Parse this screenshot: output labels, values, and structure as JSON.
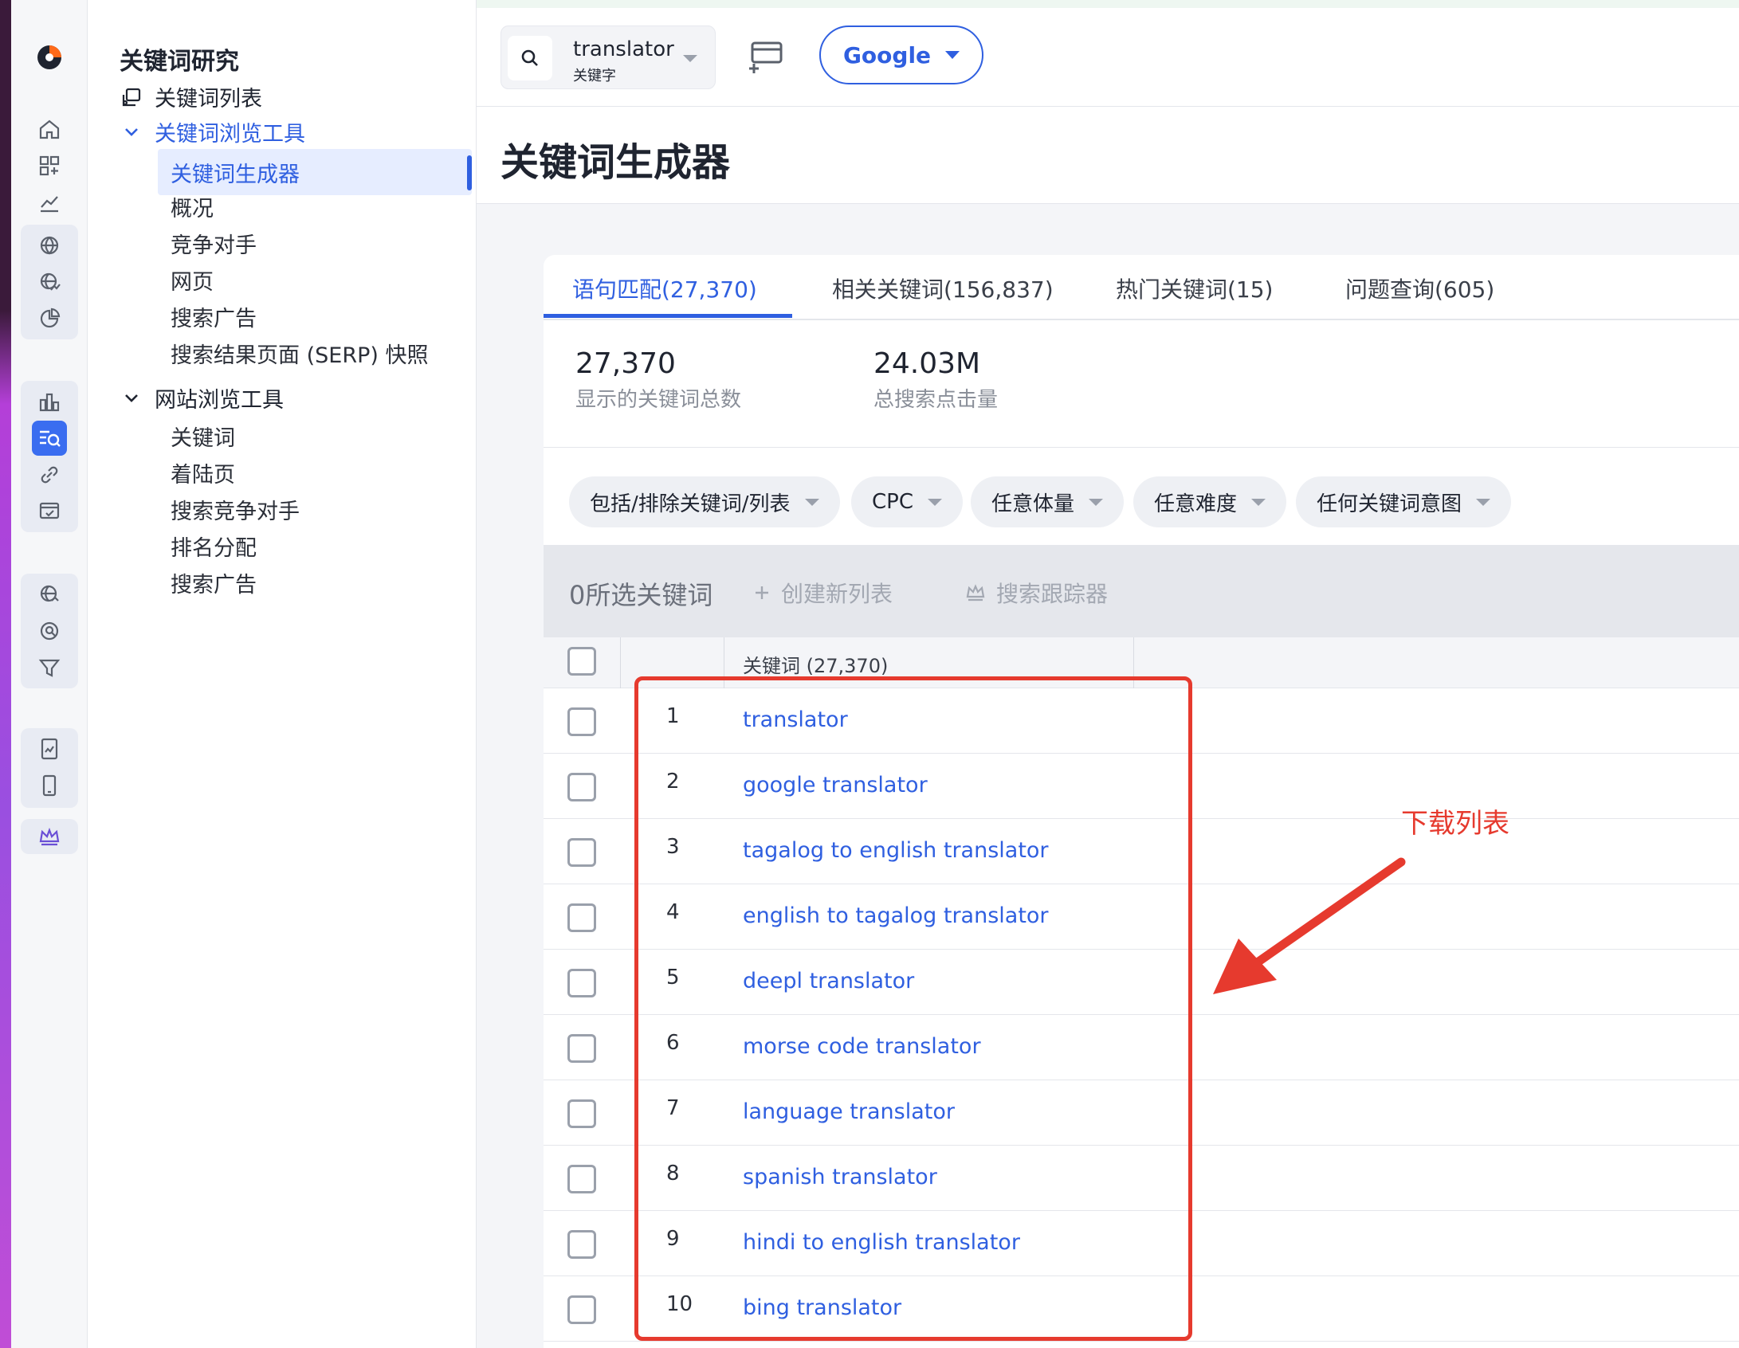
{
  "app": {
    "section_title": "关键词研究",
    "page_title": "关键词生成器"
  },
  "nav": {
    "list_label": "关键词列表",
    "kw_tools_label": "关键词浏览工具",
    "kw_tools_items": [
      "关键词生成器",
      "概况",
      "竞争对手",
      "网页",
      "搜索广告",
      "搜索结果页面 (SERP) 快照"
    ],
    "site_tools_label": "网站浏览工具",
    "site_tools_items": [
      "关键词",
      "着陆页",
      "搜索竞争对手",
      "排名分配",
      "搜索广告"
    ]
  },
  "search": {
    "value": "translator",
    "sublabel": "关键字"
  },
  "engine": {
    "label": "Google"
  },
  "tabs": [
    {
      "label": "语句匹配(27,370)",
      "active": true
    },
    {
      "label": "相关关键词(156,837)",
      "active": false
    },
    {
      "label": "热门关键词(15)",
      "active": false
    },
    {
      "label": "问题查询(605)",
      "active": false
    }
  ],
  "stats": [
    {
      "value": "27,370",
      "label": "显示的关键词总数"
    },
    {
      "value": "24.03M",
      "label": "总搜索点击量"
    }
  ],
  "filters": [
    "包括/排除关键词/列表",
    "CPC",
    "任意体量",
    "任意难度",
    "任何关键词意图"
  ],
  "selection": {
    "count_label": "0所选关键词",
    "create_list": "创建新列表",
    "tracker": "搜索跟踪器"
  },
  "table": {
    "keyword_header": "关键词 (27,370)",
    "rows": [
      {
        "index": "1",
        "keyword": "translator"
      },
      {
        "index": "2",
        "keyword": "google translator"
      },
      {
        "index": "3",
        "keyword": "tagalog to english translator"
      },
      {
        "index": "4",
        "keyword": "english to tagalog translator"
      },
      {
        "index": "5",
        "keyword": "deepl translator"
      },
      {
        "index": "6",
        "keyword": "morse code translator"
      },
      {
        "index": "7",
        "keyword": "language translator"
      },
      {
        "index": "8",
        "keyword": "spanish translator"
      },
      {
        "index": "9",
        "keyword": "hindi to english translator"
      },
      {
        "index": "10",
        "keyword": "bing translator"
      }
    ]
  },
  "annotation": {
    "text": "下载列表",
    "color": "#e63a2e"
  },
  "colors": {
    "accent": "#2f5fe0",
    "annotation": "#e63a2e"
  }
}
